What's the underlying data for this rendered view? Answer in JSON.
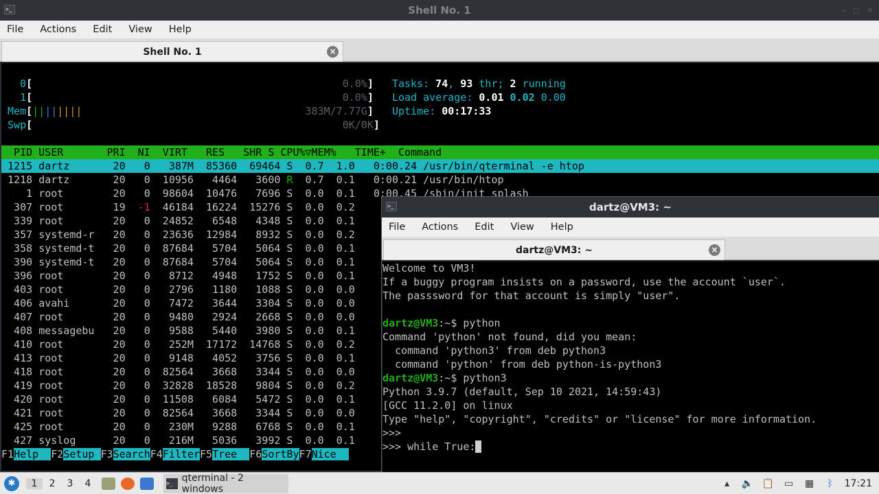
{
  "window1": {
    "title": "Shell No. 1",
    "menu": [
      "File",
      "Actions",
      "Edit",
      "View",
      "Help"
    ],
    "tab_label": "Shell No. 1",
    "meters": {
      "cpu0_label": "0",
      "cpu0_value": "0.0%",
      "cpu1_label": "1",
      "cpu1_value": "0.0%",
      "mem_label": "Mem",
      "mem_value": "383M/7.77G",
      "swp_label": "Swp",
      "swp_value": "0K/0K"
    },
    "stats": {
      "tasks_label": "Tasks:",
      "tasks": "74",
      "thr": "93",
      "thr_label": "thr;",
      "running": "2",
      "running_label": "running",
      "load_label": "Load average:",
      "load1": "0.01",
      "load5": "0.02",
      "load15": "0.00",
      "uptime_label": "Uptime:",
      "uptime": "00:17:33"
    },
    "header": "  PID USER       PRI  NI  VIRT   RES   SHR S CPU%▽MEM%   TIME+  Command                                                         ",
    "rows": [
      {
        "pid": "1215",
        "user": "dartz",
        "pri": "20",
        "ni": "0",
        "virt": "387M",
        "res": "85360",
        "shr": "69464",
        "s": "S",
        "cpu": "0.7",
        "mem": "1.0",
        "time": "0:00.24",
        "cmd": "/usr/bin/qterminal -e htop"
      },
      {
        "pid": "1218",
        "user": "dartz",
        "pri": "20",
        "ni": "0",
        "virt": "10956",
        "res": "4464",
        "shr": "3600",
        "s": "R",
        "cpu": "0.7",
        "mem": "0.1",
        "time": "0:00.21",
        "cmd": "/usr/bin/htop"
      },
      {
        "pid": "1",
        "user": "root",
        "pri": "20",
        "ni": "0",
        "virt": "98604",
        "res": "10476",
        "shr": "7696",
        "s": "S",
        "cpu": "0.0",
        "mem": "0.1",
        "time": "0:00.45",
        "cmd": "/sbin/init splash"
      },
      {
        "pid": "307",
        "user": "root",
        "pri": "19",
        "ni": "-1",
        "virt": "46184",
        "res": "16224",
        "shr": "15276",
        "s": "S",
        "cpu": "0.0",
        "mem": "0.2",
        "time": "",
        "cmd": ""
      },
      {
        "pid": "339",
        "user": "root",
        "pri": "20",
        "ni": "0",
        "virt": "24852",
        "res": "6548",
        "shr": "4348",
        "s": "S",
        "cpu": "0.0",
        "mem": "0.1",
        "time": "",
        "cmd": ""
      },
      {
        "pid": "357",
        "user": "systemd-r",
        "pri": "20",
        "ni": "0",
        "virt": "23636",
        "res": "12984",
        "shr": "8932",
        "s": "S",
        "cpu": "0.0",
        "mem": "0.2",
        "time": "",
        "cmd": ""
      },
      {
        "pid": "358",
        "user": "systemd-t",
        "pri": "20",
        "ni": "0",
        "virt": "87684",
        "res": "5704",
        "shr": "5064",
        "s": "S",
        "cpu": "0.0",
        "mem": "0.1",
        "time": "",
        "cmd": ""
      },
      {
        "pid": "390",
        "user": "systemd-t",
        "pri": "20",
        "ni": "0",
        "virt": "87684",
        "res": "5704",
        "shr": "5064",
        "s": "S",
        "cpu": "0.0",
        "mem": "0.1",
        "time": "",
        "cmd": ""
      },
      {
        "pid": "396",
        "user": "root",
        "pri": "20",
        "ni": "0",
        "virt": "8712",
        "res": "4948",
        "shr": "1752",
        "s": "S",
        "cpu": "0.0",
        "mem": "0.1",
        "time": "",
        "cmd": ""
      },
      {
        "pid": "403",
        "user": "root",
        "pri": "20",
        "ni": "0",
        "virt": "2796",
        "res": "1180",
        "shr": "1088",
        "s": "S",
        "cpu": "0.0",
        "mem": "0.0",
        "time": "",
        "cmd": ""
      },
      {
        "pid": "406",
        "user": "avahi",
        "pri": "20",
        "ni": "0",
        "virt": "7472",
        "res": "3644",
        "shr": "3304",
        "s": "S",
        "cpu": "0.0",
        "mem": "0.0",
        "time": "",
        "cmd": ""
      },
      {
        "pid": "407",
        "user": "root",
        "pri": "20",
        "ni": "0",
        "virt": "9480",
        "res": "2924",
        "shr": "2668",
        "s": "S",
        "cpu": "0.0",
        "mem": "0.0",
        "time": "",
        "cmd": ""
      },
      {
        "pid": "408",
        "user": "messagebu",
        "pri": "20",
        "ni": "0",
        "virt": "9588",
        "res": "5440",
        "shr": "3980",
        "s": "S",
        "cpu": "0.0",
        "mem": "0.1",
        "time": "",
        "cmd": ""
      },
      {
        "pid": "410",
        "user": "root",
        "pri": "20",
        "ni": "0",
        "virt": "252M",
        "res": "17172",
        "shr": "14768",
        "s": "S",
        "cpu": "0.0",
        "mem": "0.2",
        "time": "",
        "cmd": ""
      },
      {
        "pid": "413",
        "user": "root",
        "pri": "20",
        "ni": "0",
        "virt": "9148",
        "res": "4052",
        "shr": "3756",
        "s": "S",
        "cpu": "0.0",
        "mem": "0.1",
        "time": "",
        "cmd": ""
      },
      {
        "pid": "418",
        "user": "root",
        "pri": "20",
        "ni": "0",
        "virt": "82564",
        "res": "3668",
        "shr": "3344",
        "s": "S",
        "cpu": "0.0",
        "mem": "0.0",
        "time": "",
        "cmd": ""
      },
      {
        "pid": "419",
        "user": "root",
        "pri": "20",
        "ni": "0",
        "virt": "32828",
        "res": "18528",
        "shr": "9804",
        "s": "S",
        "cpu": "0.0",
        "mem": "0.2",
        "time": "",
        "cmd": ""
      },
      {
        "pid": "420",
        "user": "root",
        "pri": "20",
        "ni": "0",
        "virt": "11508",
        "res": "6084",
        "shr": "5472",
        "s": "S",
        "cpu": "0.0",
        "mem": "0.1",
        "time": "",
        "cmd": ""
      },
      {
        "pid": "421",
        "user": "root",
        "pri": "20",
        "ni": "0",
        "virt": "82564",
        "res": "3668",
        "shr": "3344",
        "s": "S",
        "cpu": "0.0",
        "mem": "0.0",
        "time": "",
        "cmd": ""
      },
      {
        "pid": "425",
        "user": "root",
        "pri": "20",
        "ni": "0",
        "virt": "230M",
        "res": "9288",
        "shr": "6768",
        "s": "S",
        "cpu": "0.0",
        "mem": "0.1",
        "time": "",
        "cmd": ""
      },
      {
        "pid": "427",
        "user": "syslog",
        "pri": "20",
        "ni": "0",
        "virt": "216M",
        "res": "5036",
        "shr": "3992",
        "s": "S",
        "cpu": "0.0",
        "mem": "0.1",
        "time": "",
        "cmd": ""
      }
    ],
    "fkeys": [
      {
        "key": "F1",
        "label": "Help  "
      },
      {
        "key": "F2",
        "label": "Setup "
      },
      {
        "key": "F3",
        "label": "Search"
      },
      {
        "key": "F4",
        "label": "Filter"
      },
      {
        "key": "F5",
        "label": "Tree  "
      },
      {
        "key": "F6",
        "label": "SortBy"
      },
      {
        "key": "F7",
        "label": "Nice  "
      }
    ]
  },
  "window2": {
    "title": "dartz@VM3: ~",
    "menu": [
      "File",
      "Actions",
      "Edit",
      "View",
      "Help"
    ],
    "tab_label": "dartz@VM3: ~",
    "lines": {
      "l1": "Welcome to VM3!",
      "l2": "If a buggy program insists on a password, use the account `user`.",
      "l3": "The passsword for that account is simply \"user\".",
      "p1_prompt": "dartz@VM3",
      "p1_rest": ":~$ python",
      "l5": "Command 'python' not found, did you mean:",
      "l6": "  command 'python3' from deb python3",
      "l7": "  command 'python' from deb python-is-python3",
      "p2_prompt": "dartz@VM3",
      "p2_rest": ":~$ python3",
      "l9": "Python 3.9.7 (default, Sep 10 2021, 14:59:43)",
      "l10": "[GCC 11.2.0] on linux",
      "l11": "Type \"help\", \"copyright\", \"credits\" or \"license\" for more information.",
      "l12": ">>>",
      "l13": ">>> while True:"
    }
  },
  "taskbar": {
    "workspaces": [
      "1",
      "2",
      "3",
      "4"
    ],
    "task_label": "qterminal - 2 windows",
    "clock": "17:21"
  },
  "colors": {
    "htop_header": "#22b01a",
    "htop_selected": "#1fb8c0",
    "prompt": "#22b01a"
  }
}
